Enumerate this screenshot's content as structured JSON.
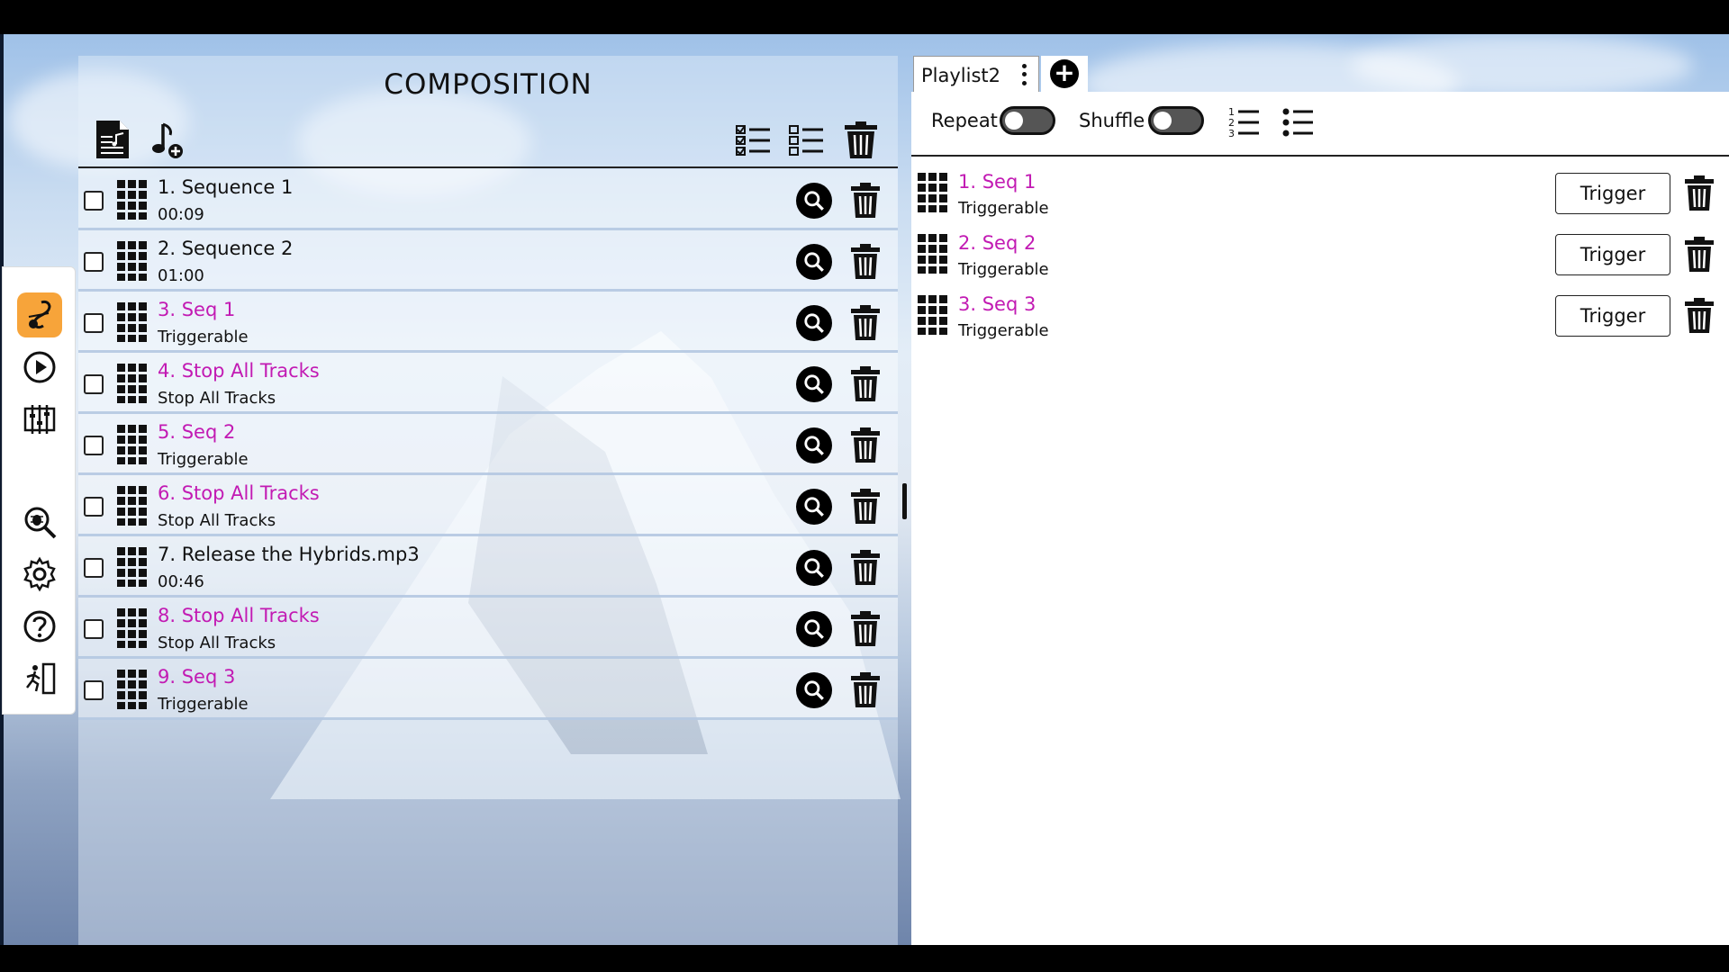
{
  "composition": {
    "title": "COMPOSITION",
    "items": [
      {
        "number": "1.",
        "title": "Sequence 1",
        "subtitle": "00:09",
        "highlight": false
      },
      {
        "number": "2.",
        "title": "Sequence 2",
        "subtitle": "01:00",
        "highlight": false
      },
      {
        "number": "3.",
        "title": "Seq 1",
        "subtitle": "Triggerable",
        "highlight": true
      },
      {
        "number": "4.",
        "title": "Stop All Tracks",
        "subtitle": "Stop All Tracks",
        "highlight": true
      },
      {
        "number": "5.",
        "title": "Seq 2",
        "subtitle": "Triggerable",
        "highlight": true
      },
      {
        "number": "6.",
        "title": "Stop All Tracks",
        "subtitle": "Stop All Tracks",
        "highlight": true
      },
      {
        "number": "7.",
        "title": "Release the Hybrids.mp3",
        "subtitle": "00:46",
        "highlight": false
      },
      {
        "number": "8.",
        "title": "Stop All Tracks",
        "subtitle": "Stop All Tracks",
        "highlight": true
      },
      {
        "number": "9.",
        "title": "Seq 3",
        "subtitle": "Triggerable",
        "highlight": true
      }
    ]
  },
  "playlist": {
    "tab_label": "Playlist2",
    "repeat_label": "Repeat",
    "shuffle_label": "Shuffle",
    "trigger_label": "Trigger",
    "items": [
      {
        "number": "1.",
        "title": "Seq 1",
        "subtitle": "Triggerable"
      },
      {
        "number": "2.",
        "title": "Seq 2",
        "subtitle": "Triggerable"
      },
      {
        "number": "3.",
        "title": "Seq 3",
        "subtitle": "Triggerable"
      }
    ]
  },
  "icons": {
    "rail": [
      "music-note-icon",
      "play-icon",
      "mixer-icon",
      "debug-icon",
      "gear-icon",
      "help-icon",
      "exit-icon"
    ],
    "composition_toolbar": [
      "document-music-icon",
      "add-music-icon",
      "checklist-icon",
      "list-icon",
      "trash-icon"
    ],
    "playlist_toolbar": [
      "numbered-list-icon",
      "bulleted-list-icon"
    ]
  },
  "colors": {
    "highlight_text": "#c21ab3",
    "active_rail": "#f7a43a"
  }
}
